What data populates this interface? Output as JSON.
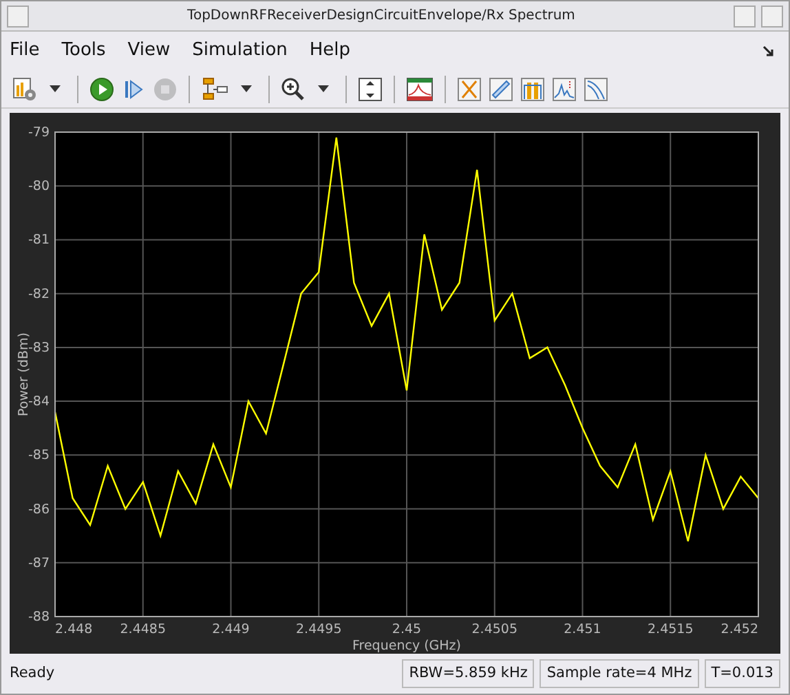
{
  "window": {
    "title": "TopDownRFReceiverDesignCircuitEnvelope/Rx Spectrum"
  },
  "menu": [
    "File",
    "Tools",
    "View",
    "Simulation",
    "Help"
  ],
  "toolbar": [
    {
      "kind": "config",
      "disabled": false
    },
    {
      "kind": "caret",
      "disabled": false
    },
    {
      "kind": "run",
      "disabled": false
    },
    {
      "kind": "step",
      "disabled": false
    },
    {
      "kind": "stop",
      "disabled": true
    },
    {
      "kind": "blocks",
      "disabled": false
    },
    {
      "kind": "caret",
      "disabled": false
    },
    {
      "kind": "zoom",
      "disabled": false
    },
    {
      "kind": "caret",
      "disabled": false
    },
    {
      "kind": "fit",
      "disabled": false
    },
    {
      "kind": "spectrum",
      "disabled": false
    },
    {
      "kind": "cursor",
      "disabled": false
    },
    {
      "kind": "ruler",
      "disabled": false
    },
    {
      "kind": "channel",
      "disabled": false
    },
    {
      "kind": "peaks",
      "disabled": false
    },
    {
      "kind": "ccdf",
      "disabled": false
    }
  ],
  "chart": {
    "chart_data": {
      "type": "line",
      "grid": true,
      "xlabel": "Frequency (GHz)",
      "ylabel": "Power (dBm)",
      "xlim": [
        2.448,
        2.452
      ],
      "ylim": [
        -88,
        -79
      ],
      "xticks": [
        {
          "value": 2.448,
          "label": "2.448"
        },
        {
          "value": 2.4485,
          "label": "2.4485"
        },
        {
          "value": 2.449,
          "label": "2.449"
        },
        {
          "value": 2.4495,
          "label": "2.4495"
        },
        {
          "value": 2.45,
          "label": "2.45"
        },
        {
          "value": 2.4505,
          "label": "2.4505"
        },
        {
          "value": 2.451,
          "label": "2.451"
        },
        {
          "value": 2.4515,
          "label": "2.4515"
        },
        {
          "value": 2.452,
          "label": "2.452"
        }
      ],
      "yticks": [
        {
          "value": -79,
          "label": "-79"
        },
        {
          "value": -80,
          "label": "-80"
        },
        {
          "value": -81,
          "label": "-81"
        },
        {
          "value": -82,
          "label": "-82"
        },
        {
          "value": -83,
          "label": "-83"
        },
        {
          "value": -84,
          "label": "-84"
        },
        {
          "value": -85,
          "label": "-85"
        },
        {
          "value": -86,
          "label": "-86"
        },
        {
          "value": -87,
          "label": "-87"
        },
        {
          "value": -88,
          "label": "-88"
        }
      ],
      "x": [
        2.448,
        2.4481,
        2.4482,
        2.4483,
        2.4484,
        2.4485,
        2.4486,
        2.4487,
        2.4488,
        2.4489,
        2.449,
        2.4491,
        2.4492,
        2.4493,
        2.4494,
        2.4495,
        2.4496,
        2.4497,
        2.4498,
        2.4499,
        2.45,
        2.4501,
        2.4502,
        2.4503,
        2.4504,
        2.4505,
        2.4506,
        2.4507,
        2.4508,
        2.4509,
        2.451,
        2.4511,
        2.4512,
        2.4513,
        2.4514,
        2.4515,
        2.4516,
        2.4517,
        2.4518,
        2.4519,
        2.452
      ],
      "series": [
        {
          "color": "#ffff00",
          "values": [
            -84.2,
            -85.8,
            -86.3,
            -85.2,
            -86.0,
            -85.5,
            -86.5,
            -85.3,
            -85.9,
            -84.8,
            -85.6,
            -84.0,
            -84.6,
            -83.3,
            -82.0,
            -81.6,
            -79.1,
            -81.8,
            -82.6,
            -82.0,
            -83.8,
            -80.9,
            -82.3,
            -81.8,
            -79.7,
            -82.5,
            -82.0,
            -83.2,
            -83.0,
            -83.7,
            -84.5,
            -85.2,
            -85.6,
            -84.8,
            -86.2,
            -85.3,
            -86.6,
            -85.0,
            -86.0,
            -85.4,
            -85.8
          ]
        }
      ]
    }
  },
  "status_bar": {
    "message": "Ready",
    "fields": [
      "RBW=5.859 kHz",
      "Sample rate=4 MHz",
      "T=0.013"
    ]
  }
}
